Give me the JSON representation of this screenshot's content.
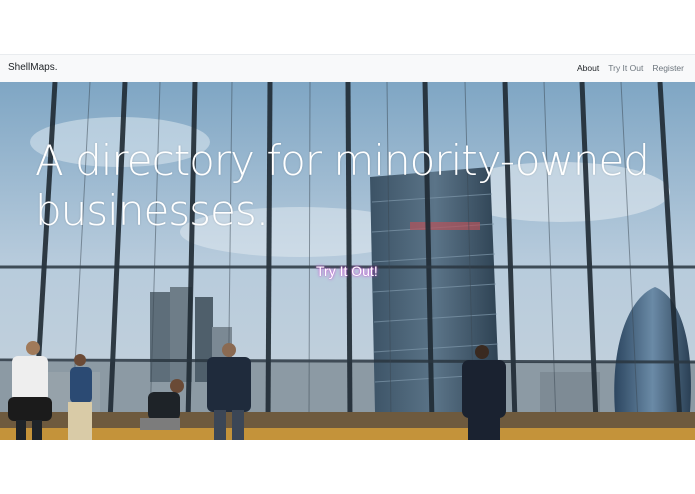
{
  "navbar": {
    "brand": "ShellMaps.",
    "links": [
      {
        "label": "About",
        "active": true
      },
      {
        "label": "Try It Out",
        "active": false
      },
      {
        "label": "Register",
        "active": false
      }
    ]
  },
  "hero": {
    "headline": "A directory for minority-owned businesses.",
    "cta_label": "Try It Out!"
  }
}
